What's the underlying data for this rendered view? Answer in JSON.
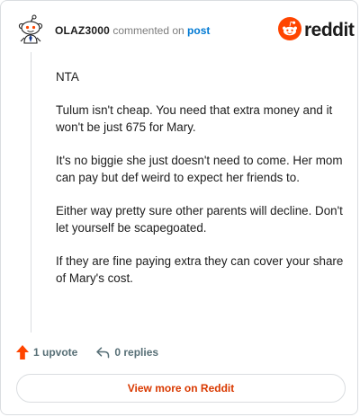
{
  "header": {
    "username": "OLAZ3000",
    "action_text": "commented on",
    "post_link": "post",
    "brand_wordmark": "reddit",
    "brand_icon": "reddit-logo-icon",
    "avatar_icon": "snoo-avatar-icon"
  },
  "comment": {
    "paragraphs": [
      "NTA",
      "Tulum isn't cheap. You need that extra money and it won't be just 675 for Mary.",
      "It's no biggie she just doesn't need to come. Her mom can pay but def weird to expect her friends to.",
      "Either way pretty sure other parents will decline. Don't let yourself be scapegoated.",
      "If they are fine paying extra they can cover your share of Mary's cost."
    ]
  },
  "actions": {
    "upvote_icon": "upvote-arrow-icon",
    "upvote_label": "1 upvote",
    "reply_icon": "reply-arrow-icon",
    "replies_label": "0 replies"
  },
  "footer": {
    "view_more_label": "View more on Reddit"
  },
  "colors": {
    "brand_orange": "#ff4500",
    "link_blue": "#0079d3",
    "button_text": "#d93900",
    "muted_text": "#576f76",
    "border": "#dadde0"
  }
}
